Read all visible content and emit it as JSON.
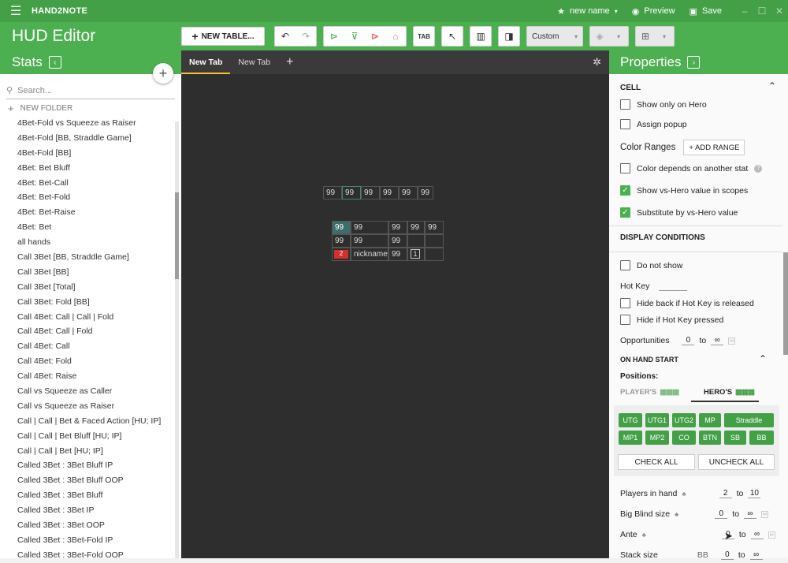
{
  "titlebar": {
    "app": "HAND2NOTE",
    "layout_name": "new name",
    "preview": "Preview",
    "save": "Save"
  },
  "toolbar": {
    "title": "HUD Editor",
    "new_table": "NEW TABLE...",
    "custom_select": "Custom"
  },
  "stats_panel": {
    "title": "Stats",
    "search_placeholder": "Search...",
    "new_folder": "NEW FOLDER",
    "items": [
      "4Bet-Fold vs Squeeze as Raiser",
      "4Bet-Fold [BB, Straddle Game]",
      "4Bet-Fold [BB]",
      "4Bet: Bet Bluff",
      "4Bet: Bet-Call",
      "4Bet: Bet-Fold",
      "4Bet: Bet-Raise",
      "4Bet: Bet",
      "all hands",
      "Call 3Bet [BB, Straddle Game]",
      "Call 3Bet [BB]",
      "Call 3Bet [Total]",
      "Call 3Bet: Fold [BB]",
      "Call 4Bet: Call | Call | Fold",
      "Call 4Bet: Call | Fold",
      "Call 4Bet: Call",
      "Call 4Bet: Fold",
      "Call 4Bet: Raise",
      "Call vs Squeeze as Caller",
      "Call vs Squeeze as Raiser",
      "Call | Call | Bet & Faced Action [HU; IP]",
      "Call | Call | Bet Bluff [HU; IP]",
      "Call | Call | Bet [HU; IP]",
      "Called 3Bet : 3Bet Bluff IP",
      "Called 3Bet : 3Bet Bluff OOP",
      "Called 3Bet : 3Bet Bluff",
      "Called 3Bet : 3Bet IP",
      "Called 3Bet : 3Bet OOP",
      "Called 3Bet : 3Bet-Fold IP",
      "Called 3Bet : 3Bet-Fold OOP"
    ]
  },
  "tabs": [
    "New Tab",
    "New Tab"
  ],
  "hud": {
    "cell_value": "99",
    "nickname": "nickname",
    "badge": "2",
    "box": "1"
  },
  "properties": {
    "title": "Properties",
    "cell_section": "CELL",
    "show_only_hero": "Show only on Hero",
    "assign_popup": "Assign popup",
    "color_ranges": "Color Ranges",
    "add_range": "+ ADD RANGE",
    "color_depends": "Color depends on another stat",
    "show_vs_hero": "Show vs-Hero value in scopes",
    "substitute": "Substitute by vs-Hero value",
    "display_conditions": "DISPLAY CONDITIONS",
    "do_not_show": "Do not show",
    "hot_key": "Hot Key",
    "hide_back": "Hide back if Hot Key is released",
    "hide_pressed": "Hide if Hot Key pressed",
    "opportunities": "Opportunities",
    "opp_from": "0",
    "to": "to",
    "infinity": "∞",
    "on_hand_start": "ON HAND START",
    "positions": "Positions:",
    "players_tab": "PLAYER'S",
    "heros_tab": "HERO'S",
    "positions_row1": [
      "UTG",
      "UTG1",
      "UTG2",
      "MP",
      "Straddle"
    ],
    "positions_row2": [
      "MP1",
      "MP2",
      "CO",
      "BTN",
      "SB",
      "BB"
    ],
    "check_all": "CHECK ALL",
    "uncheck_all": "UNCHECK ALL",
    "players_in_hand": "Players in hand",
    "pih_from": "2",
    "pih_to": "10",
    "big_blind_size": "Big Blind size",
    "bb_from": "0",
    "ante": "Ante",
    "ante_from": "0",
    "stack_size": "Stack size",
    "stack_unit": "BB",
    "stack_from": "0"
  }
}
